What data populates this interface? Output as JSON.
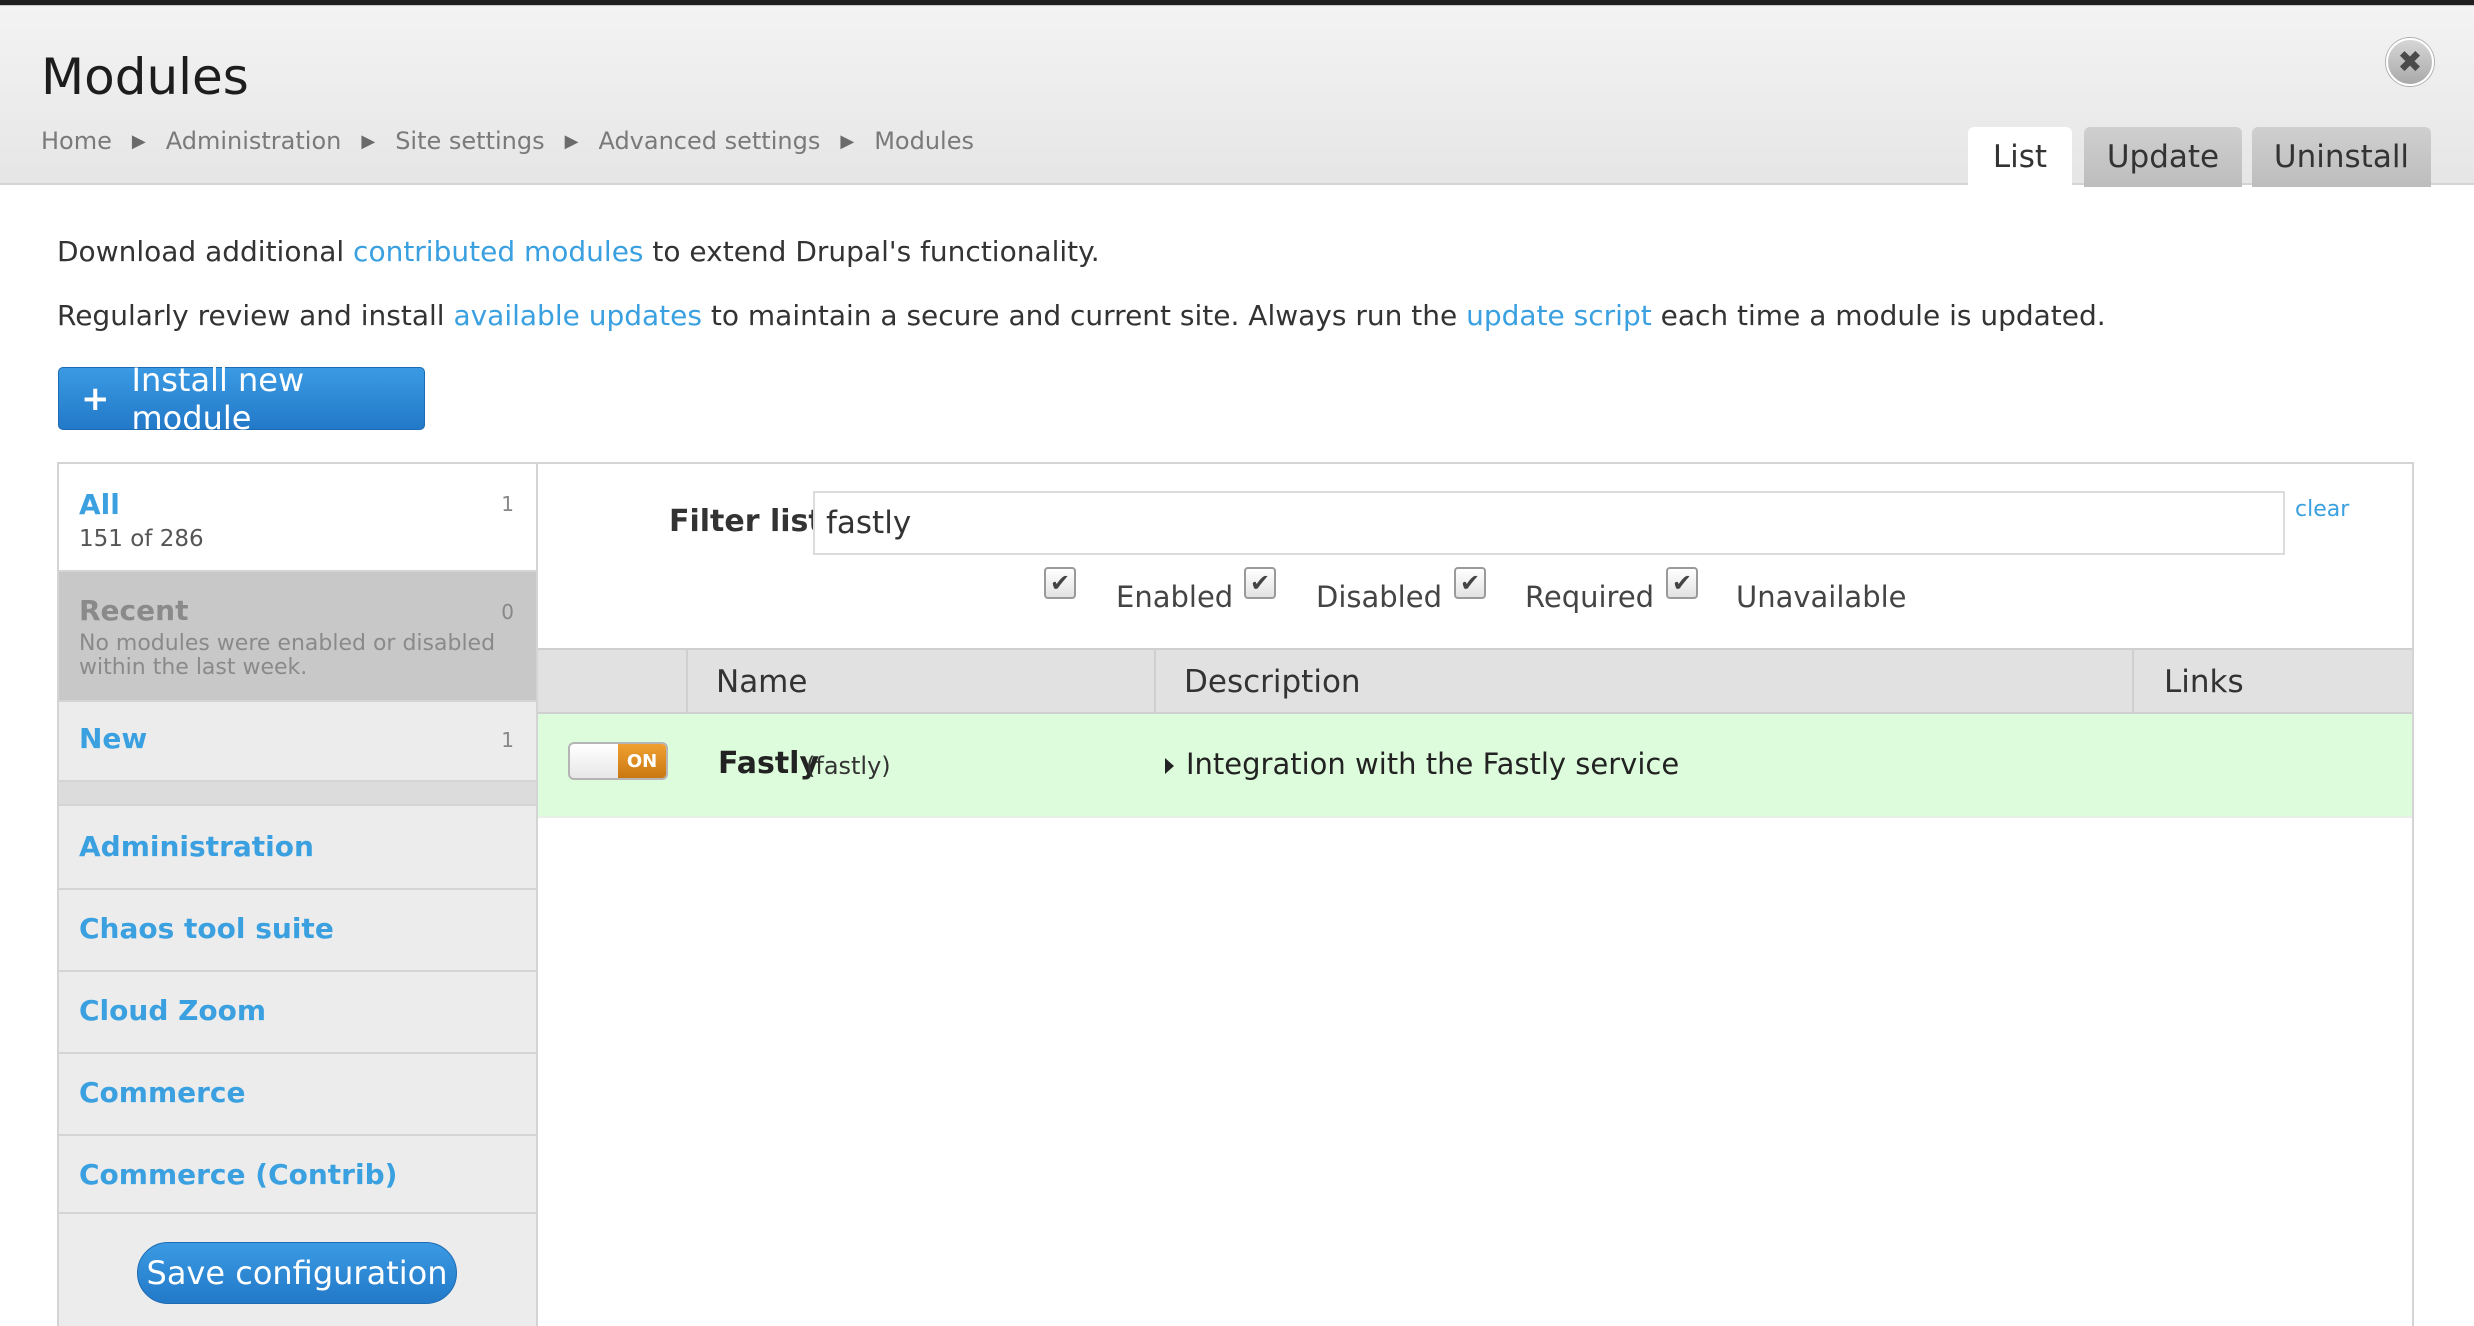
{
  "header": {
    "title": "Modules",
    "breadcrumb": [
      "Home",
      "Administration",
      "Site settings",
      "Advanced settings",
      "Modules"
    ],
    "close_icon": "✖",
    "tabs": [
      {
        "label": "List",
        "active": true
      },
      {
        "label": "Update",
        "active": false
      },
      {
        "label": "Uninstall",
        "active": false
      }
    ]
  },
  "intro": {
    "line1_pre": "Download additional ",
    "line1_link": "contributed modules",
    "line1_post": " to extend Drupal's functionality.",
    "line2_pre": "Regularly review and install ",
    "line2_link1": "available updates",
    "line2_mid": " to maintain a secure and current site. Always run the ",
    "line2_link2": "update script",
    "line2_post": " each time a module is updated."
  },
  "install_button": {
    "icon": "+",
    "label": "Install new module"
  },
  "sidebar": {
    "all": {
      "label": "All",
      "count": "1",
      "sub": "151 of 286"
    },
    "recent": {
      "label": "Recent",
      "count": "0",
      "sub": "No modules were enabled or disabled within the last week."
    },
    "new": {
      "label": "New",
      "count": "1"
    },
    "categories": [
      "Administration",
      "Chaos tool suite",
      "Cloud Zoom",
      "Commerce",
      "Commerce (Contrib)"
    ],
    "save_label": "Save configuration"
  },
  "filter": {
    "label": "Filter list",
    "value": "fastly",
    "clear": "clear",
    "checkboxes": [
      {
        "label": "Enabled",
        "checked": true
      },
      {
        "label": "Disabled",
        "checked": true
      },
      {
        "label": "Required",
        "checked": true
      },
      {
        "label": "Unavailable",
        "checked": true
      }
    ]
  },
  "table": {
    "columns": [
      "",
      "Name",
      "Description",
      "Links"
    ],
    "rows": [
      {
        "toggle": "ON",
        "name": "Fastly",
        "machine": "(fastly)",
        "description": "Integration with the Fastly service"
      }
    ]
  },
  "colors": {
    "link": "#3aa0e0",
    "button": "#2a85d0",
    "row_enabled": "#ddfcdc",
    "toggle_on": "#e08a1c"
  }
}
